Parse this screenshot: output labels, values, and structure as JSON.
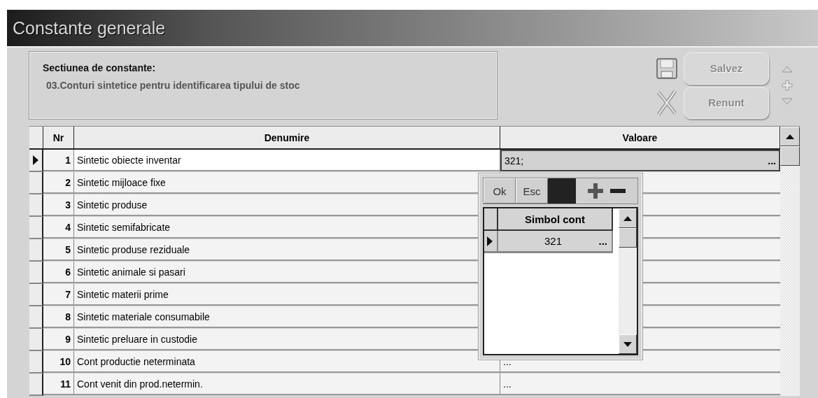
{
  "window": {
    "title": "Constante generale"
  },
  "section": {
    "label": "Sectiunea de constante:",
    "value": "03.Conturi sintetice pentru identificarea tipului de stoc"
  },
  "actions": [
    {
      "kind": "save",
      "label": "Salvez",
      "disabled": true
    },
    {
      "kind": "cancel",
      "label": "Renunt",
      "disabled": true
    }
  ],
  "table": {
    "columns": [
      "Nr",
      "Denumire",
      "Valoare"
    ],
    "rows": [
      {
        "nr": "1",
        "name": "Sintetic obiecte inventar",
        "value": "321;",
        "button": "...",
        "selected": true
      },
      {
        "nr": "2",
        "name": "Sintetic mijloace fixe",
        "selected": false
      },
      {
        "nr": "3",
        "name": "Sintetic produse",
        "selected": false
      },
      {
        "nr": "4",
        "name": "Sintetic semifabricate",
        "selected": false
      },
      {
        "nr": "5",
        "name": "Sintetic produse reziduale",
        "selected": false
      },
      {
        "nr": "6",
        "name": "Sintetic animale si pasari",
        "selected": false
      },
      {
        "nr": "7",
        "name": "Sintetic materii prime",
        "selected": false
      },
      {
        "nr": "8",
        "name": "Sintetic materiale consumabile",
        "selected": false
      },
      {
        "nr": "9",
        "name": "Sintetic preluare in custodie",
        "selected": false
      },
      {
        "nr": "10",
        "name": "Cont productie neterminata",
        "value": "...",
        "selected": false
      },
      {
        "nr": "11",
        "name": "Cont venit din prod.netermin.",
        "value": "...",
        "selected": false
      }
    ]
  },
  "popup": {
    "buttons": [
      "Ok",
      "Esc"
    ],
    "column": "Simbol cont",
    "rows": [
      {
        "value": "321",
        "button": "...",
        "selected": true
      }
    ]
  }
}
